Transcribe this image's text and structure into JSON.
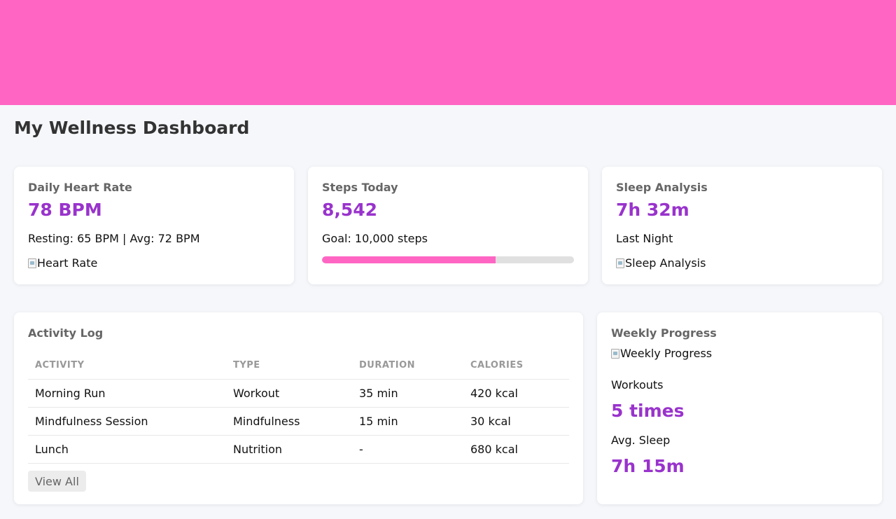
{
  "page_title": "My Wellness Dashboard",
  "colors": {
    "banner": "#ff66c4",
    "accent": "#9933cc",
    "progress": "#ff66c4"
  },
  "heart": {
    "title": "Daily Heart Rate",
    "value": "78 BPM",
    "detail": "Resting: 65 BPM | Avg: 72 BPM",
    "image_alt": "Heart Rate"
  },
  "steps": {
    "title": "Steps Today",
    "value": "8,542",
    "goal": "Goal: 10,000 steps",
    "progress_fraction": 0.69
  },
  "sleep": {
    "title": "Sleep Analysis",
    "value": "7h 32m",
    "detail": "Last Night",
    "image_alt": "Sleep Analysis"
  },
  "activity": {
    "title": "Activity Log",
    "columns": [
      "ACTIVITY",
      "TYPE",
      "DURATION",
      "CALORIES"
    ],
    "rows": [
      [
        "Morning Run",
        "Workout",
        "35 min",
        "420 kcal"
      ],
      [
        "Mindfulness Session",
        "Mindfulness",
        "15 min",
        "30 kcal"
      ],
      [
        "Lunch",
        "Nutrition",
        "-",
        "680 kcal"
      ]
    ],
    "view_all_label": "View All"
  },
  "weekly": {
    "title": "Weekly Progress",
    "image_alt": "Weekly Progress",
    "workouts_label": "Workouts",
    "workouts_value": "5 times",
    "sleep_label": "Avg. Sleep",
    "sleep_value": "7h 15m"
  }
}
